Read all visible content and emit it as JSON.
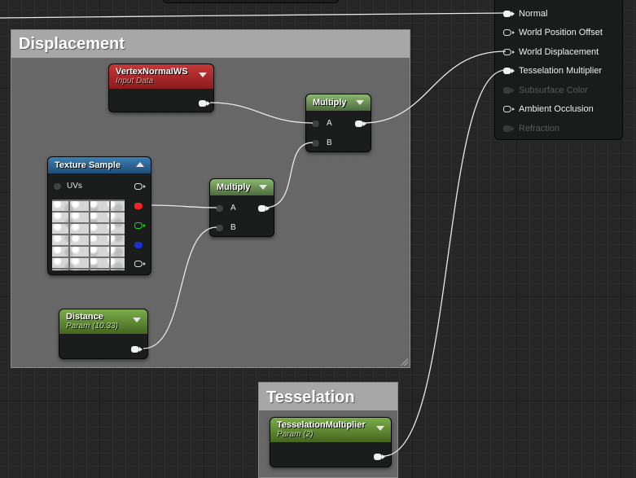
{
  "comments": [
    {
      "id": "displacement",
      "title": "Displacement"
    },
    {
      "id": "tesselation",
      "title": "Tesselation"
    }
  ],
  "nodes": {
    "vertex_normal": {
      "title": "VertexNormalWS",
      "subtitle": "Input Data"
    },
    "texture_sample": {
      "title": "Texture Sample",
      "uvs_label": "UVs"
    },
    "multiply_1": {
      "title": "Multiply",
      "pin_a": "A",
      "pin_b": "B"
    },
    "multiply_2": {
      "title": "Multiply",
      "pin_a": "A",
      "pin_b": "B"
    },
    "distance": {
      "title": "Distance",
      "subtitle": "Param (10.33)"
    },
    "tesselation_multiplier": {
      "title": "TesselationMultiplier",
      "subtitle": "Param (2)"
    }
  },
  "material_inputs": [
    {
      "label": "Normal",
      "enabled": true
    },
    {
      "label": "World Position Offset",
      "enabled": true
    },
    {
      "label": "World Displacement",
      "enabled": true
    },
    {
      "label": "Tesselation Multiplier",
      "enabled": true
    },
    {
      "label": "Subsurface Color",
      "enabled": false
    },
    {
      "label": "Ambient Occlusion",
      "enabled": true
    },
    {
      "label": "Refraction",
      "enabled": false
    }
  ],
  "colors": {
    "wire": "#e8e8e8",
    "param_header": "#6a9a3c",
    "input_header": "#a52a2a",
    "math_header": "#77a262",
    "texture_header": "#2f6fa3"
  }
}
